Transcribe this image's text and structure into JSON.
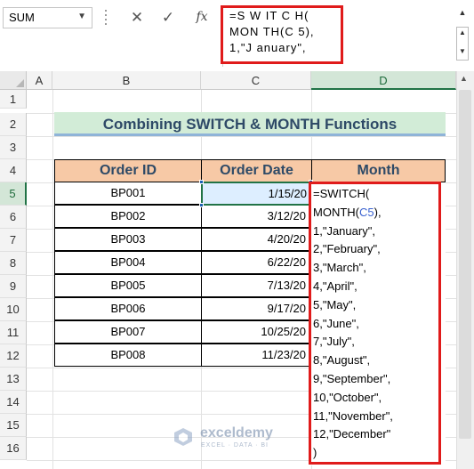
{
  "name_box": "SUM",
  "formula_bar": {
    "fx_label": "fx",
    "visible_text": "=S W IT C H(\nMON TH(C 5),\n1,\"J anuary\","
  },
  "columns": [
    "A",
    "B",
    "C",
    "D"
  ],
  "rows": [
    "1",
    "2",
    "3",
    "4",
    "5",
    "6",
    "7",
    "8",
    "9",
    "10",
    "11",
    "12",
    "13",
    "14",
    "15",
    "16"
  ],
  "sheet": {
    "title": "Combining SWITCH & MONTH Functions",
    "headers": [
      "Order ID",
      "Order Date",
      "Month"
    ],
    "data_rows": [
      {
        "id": "BP001",
        "date": "1/15/20"
      },
      {
        "id": "BP002",
        "date": "3/12/20"
      },
      {
        "id": "BP003",
        "date": "4/20/20"
      },
      {
        "id": "BP004",
        "date": "6/22/20"
      },
      {
        "id": "BP005",
        "date": "7/13/20"
      },
      {
        "id": "BP006",
        "date": "9/17/20"
      },
      {
        "id": "BP007",
        "date": "10/25/20"
      },
      {
        "id": "BP008",
        "date": "11/23/20"
      }
    ],
    "editing_cell": {
      "line1": "=SWITCH(",
      "line2_fn": "MONTH(",
      "line2_ref": "C5",
      "line2_end": "),",
      "rest": "1,\"January\",\n2,\"February\",\n3,\"March\",\n4,\"April\",\n5,\"May\",\n6,\"June\",\n7,\"July\",\n8,\"August\",\n9,\"September\",\n10,\"October\",\n11,\"November\",\n12,\"December\"\n)"
    }
  },
  "watermark": {
    "name": "exceldemy",
    "tagline": "EXCEL · DATA · BI"
  },
  "colors": {
    "accent_green": "#217346",
    "highlight_red": "#e01b1b",
    "header_fill": "#f7c9a6",
    "title_fill": "#d2ecd7",
    "ref_blue": "#3b63d0"
  }
}
